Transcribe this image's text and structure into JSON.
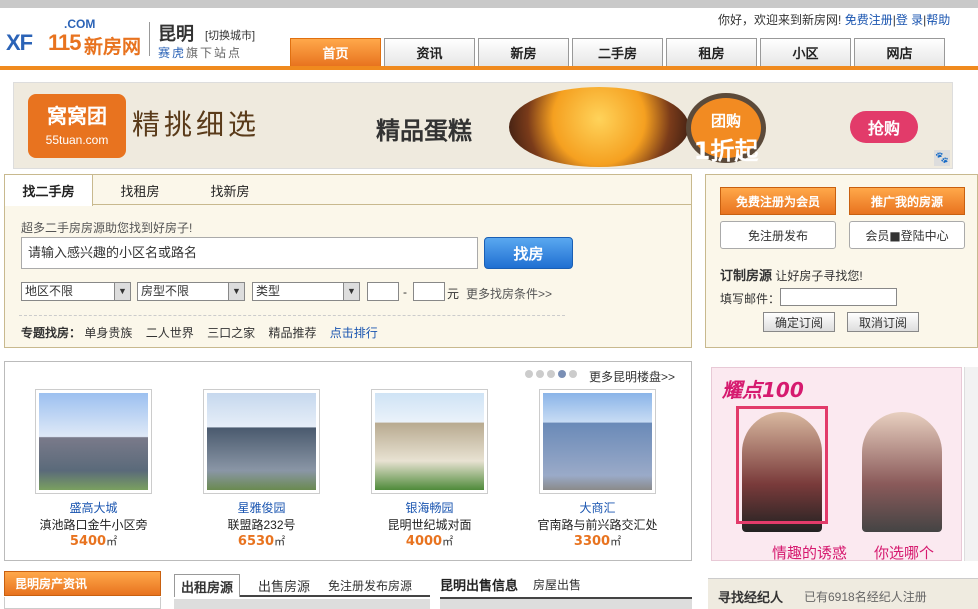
{
  "header": {
    "logo_xf": "XF",
    "logo_num": "115",
    "logo_com": ".COM",
    "logo_cn": "新房网",
    "city": "昆明",
    "switch_city": "[切换城市]",
    "subsite_brand": "赛虎",
    "subsite_rest": "旗下站点",
    "greeting": "你好，欢迎来到新房网!",
    "register_link": "免费注册",
    "login_link": "登 录",
    "help_link": "帮助",
    "sep": "|"
  },
  "nav": {
    "tabs": [
      {
        "label": "首页",
        "active": true
      },
      {
        "label": "资讯",
        "active": false
      },
      {
        "label": "新房",
        "active": false
      },
      {
        "label": "二手房",
        "active": false
      },
      {
        "label": "租房",
        "active": false
      },
      {
        "label": "小区",
        "active": false
      },
      {
        "label": "网店",
        "active": false
      }
    ]
  },
  "banner": {
    "brand": "窝窝团",
    "brand_url": "55tuan.com",
    "slogan": "精挑细选",
    "product": "精品蛋糕",
    "deal_line1": "团购",
    "deal_line2": "1折起",
    "grab": "抢购",
    "paw": "🐾"
  },
  "search": {
    "tabs": [
      "找二手房",
      "找租房",
      "找新房"
    ],
    "hint": "超多二手房房源助您找到好房子!",
    "input_value": "请输入感兴趣的小区名或路名",
    "button": "找房",
    "district": "地区不限",
    "room_type": "房型不限",
    "type": "类型",
    "price_sep": "-",
    "price_unit": "元",
    "more": "更多找房条件>>",
    "topic_label": "专题找房：",
    "topics": [
      "单身贵族",
      "二人世界",
      "三口之家",
      "精品推荐"
    ],
    "rank": "点击排行"
  },
  "member": {
    "register": "免费注册为会员",
    "promote": "推广我的房源",
    "publish": "免注册发布",
    "login_center": "会员■登陆中心",
    "custom_title": "订制房源",
    "custom_sub": "让好房子寻找您!",
    "email_label": "填写邮件：",
    "confirm": "确定订阅",
    "cancel": "取消订阅"
  },
  "listings": {
    "more": "更多昆明楼盘>>",
    "unit": "㎡",
    "items": [
      {
        "name": "盛高大城",
        "addr": "滇池路口金牛小区旁",
        "price": "5400"
      },
      {
        "name": "星雅俊园",
        "addr": "联盟路232号",
        "price": "6530"
      },
      {
        "name": "银海畅园",
        "addr": "昆明世纪城对面",
        "price": "4000"
      },
      {
        "name": "大商汇",
        "addr": "官南路与前兴路交汇处",
        "price": "3300"
      }
    ]
  },
  "ad": {
    "title": "耀点100",
    "cap1": "情趣的诱惑",
    "cap2": "你选哪个"
  },
  "bottom": {
    "news": "昆明房产资讯",
    "rent_tab": "出租房源",
    "sale_tab": "出售房源",
    "free_publish": "免注册发布房源",
    "sale_title": "昆明出售信息",
    "sale_sub": "房屋出售",
    "agent_title": "寻找经纪人",
    "agent_count": "已有6918名经纪人注册"
  },
  "colors": {
    "accent": "#e8731f",
    "link": "#1a55b0",
    "panel": "#fbf7ea"
  }
}
